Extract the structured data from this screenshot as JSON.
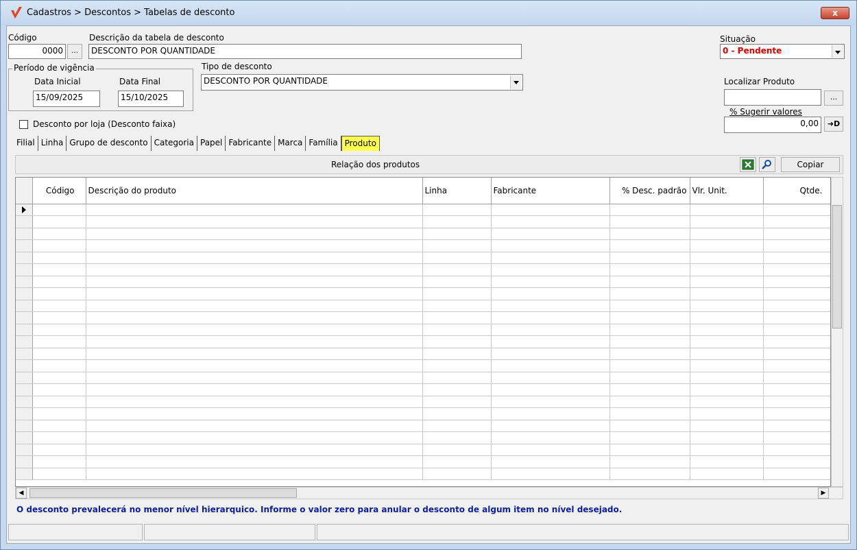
{
  "window": {
    "title": "Cadastros > Descontos > Tabelas de desconto",
    "close_label": "x"
  },
  "form": {
    "codigo_label": "Código",
    "codigo_value": "0000",
    "codigo_lookup_label": "...",
    "descricao_label": "Descrição da tabela de desconto",
    "descricao_value": "DESCONTO POR QUANTIDADE",
    "situacao_label": "Situação",
    "situacao_value": "0 - Pendente",
    "situacao_color": "#e00000",
    "periodo_label": "Período de vigência",
    "data_inicial_label": "Data Inicial",
    "data_inicial_value": "15/09/2025",
    "data_final_label": "Data Final",
    "data_final_value": "15/10/2025",
    "tipo_label": "Tipo de desconto",
    "tipo_value": "DESCONTO POR QUANTIDADE",
    "localizar_label": "Localizar Produto",
    "localizar_value": "",
    "localizar_lookup_label": "...",
    "sugerir_label": "% Sugerir valores",
    "sugerir_value": "0,00",
    "sugerir_apply_label": "➜D",
    "desconto_loja_label": "Desconto por loja (Desconto faixa)",
    "desconto_loja_checked": false
  },
  "tabs": [
    {
      "label": "Filial"
    },
    {
      "label": "Linha"
    },
    {
      "label": "Grupo de desconto"
    },
    {
      "label": "Categoria"
    },
    {
      "label": "Papel"
    },
    {
      "label": "Fabricante"
    },
    {
      "label": "Marca"
    },
    {
      "label": "Família"
    },
    {
      "label": "Produto",
      "active": true
    }
  ],
  "panel": {
    "title": "Relação dos produtos",
    "excel_icon": "excel-icon",
    "search_icon": "magnifier-icon",
    "copy_label": "Copiar"
  },
  "grid": {
    "columns": [
      "Código",
      "Descrição do produto",
      "Linha",
      "Fabricante",
      "% Desc. padrão",
      "Vlr. Unit.",
      "Qtde."
    ],
    "row_count": 23
  },
  "footer": {
    "info": "O desconto prevalecerá no menor nível hierarquico. Informe o valor zero para anular o desconto de algum item no nível desejado."
  }
}
